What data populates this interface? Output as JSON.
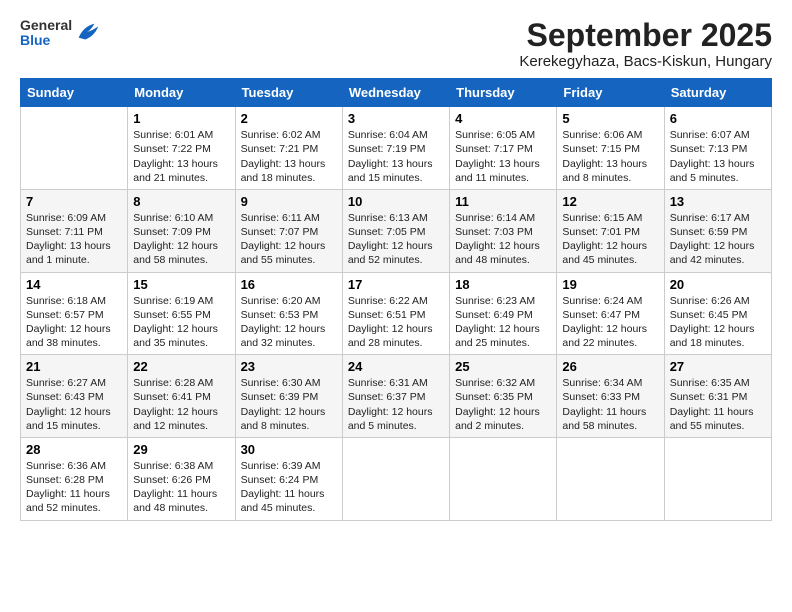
{
  "header": {
    "logo": {
      "general": "General",
      "blue": "Blue"
    },
    "title": "September 2025",
    "subtitle": "Kerekegyhaza, Bacs-Kiskun, Hungary"
  },
  "calendar": {
    "days_of_week": [
      "Sunday",
      "Monday",
      "Tuesday",
      "Wednesday",
      "Thursday",
      "Friday",
      "Saturday"
    ],
    "weeks": [
      [
        {
          "day": "",
          "info": ""
        },
        {
          "day": "1",
          "info": "Sunrise: 6:01 AM\nSunset: 7:22 PM\nDaylight: 13 hours\nand 21 minutes."
        },
        {
          "day": "2",
          "info": "Sunrise: 6:02 AM\nSunset: 7:21 PM\nDaylight: 13 hours\nand 18 minutes."
        },
        {
          "day": "3",
          "info": "Sunrise: 6:04 AM\nSunset: 7:19 PM\nDaylight: 13 hours\nand 15 minutes."
        },
        {
          "day": "4",
          "info": "Sunrise: 6:05 AM\nSunset: 7:17 PM\nDaylight: 13 hours\nand 11 minutes."
        },
        {
          "day": "5",
          "info": "Sunrise: 6:06 AM\nSunset: 7:15 PM\nDaylight: 13 hours\nand 8 minutes."
        },
        {
          "day": "6",
          "info": "Sunrise: 6:07 AM\nSunset: 7:13 PM\nDaylight: 13 hours\nand 5 minutes."
        }
      ],
      [
        {
          "day": "7",
          "info": "Sunrise: 6:09 AM\nSunset: 7:11 PM\nDaylight: 13 hours\nand 1 minute."
        },
        {
          "day": "8",
          "info": "Sunrise: 6:10 AM\nSunset: 7:09 PM\nDaylight: 12 hours\nand 58 minutes."
        },
        {
          "day": "9",
          "info": "Sunrise: 6:11 AM\nSunset: 7:07 PM\nDaylight: 12 hours\nand 55 minutes."
        },
        {
          "day": "10",
          "info": "Sunrise: 6:13 AM\nSunset: 7:05 PM\nDaylight: 12 hours\nand 52 minutes."
        },
        {
          "day": "11",
          "info": "Sunrise: 6:14 AM\nSunset: 7:03 PM\nDaylight: 12 hours\nand 48 minutes."
        },
        {
          "day": "12",
          "info": "Sunrise: 6:15 AM\nSunset: 7:01 PM\nDaylight: 12 hours\nand 45 minutes."
        },
        {
          "day": "13",
          "info": "Sunrise: 6:17 AM\nSunset: 6:59 PM\nDaylight: 12 hours\nand 42 minutes."
        }
      ],
      [
        {
          "day": "14",
          "info": "Sunrise: 6:18 AM\nSunset: 6:57 PM\nDaylight: 12 hours\nand 38 minutes."
        },
        {
          "day": "15",
          "info": "Sunrise: 6:19 AM\nSunset: 6:55 PM\nDaylight: 12 hours\nand 35 minutes."
        },
        {
          "day": "16",
          "info": "Sunrise: 6:20 AM\nSunset: 6:53 PM\nDaylight: 12 hours\nand 32 minutes."
        },
        {
          "day": "17",
          "info": "Sunrise: 6:22 AM\nSunset: 6:51 PM\nDaylight: 12 hours\nand 28 minutes."
        },
        {
          "day": "18",
          "info": "Sunrise: 6:23 AM\nSunset: 6:49 PM\nDaylight: 12 hours\nand 25 minutes."
        },
        {
          "day": "19",
          "info": "Sunrise: 6:24 AM\nSunset: 6:47 PM\nDaylight: 12 hours\nand 22 minutes."
        },
        {
          "day": "20",
          "info": "Sunrise: 6:26 AM\nSunset: 6:45 PM\nDaylight: 12 hours\nand 18 minutes."
        }
      ],
      [
        {
          "day": "21",
          "info": "Sunrise: 6:27 AM\nSunset: 6:43 PM\nDaylight: 12 hours\nand 15 minutes."
        },
        {
          "day": "22",
          "info": "Sunrise: 6:28 AM\nSunset: 6:41 PM\nDaylight: 12 hours\nand 12 minutes."
        },
        {
          "day": "23",
          "info": "Sunrise: 6:30 AM\nSunset: 6:39 PM\nDaylight: 12 hours\nand 8 minutes."
        },
        {
          "day": "24",
          "info": "Sunrise: 6:31 AM\nSunset: 6:37 PM\nDaylight: 12 hours\nand 5 minutes."
        },
        {
          "day": "25",
          "info": "Sunrise: 6:32 AM\nSunset: 6:35 PM\nDaylight: 12 hours\nand 2 minutes."
        },
        {
          "day": "26",
          "info": "Sunrise: 6:34 AM\nSunset: 6:33 PM\nDaylight: 11 hours\nand 58 minutes."
        },
        {
          "day": "27",
          "info": "Sunrise: 6:35 AM\nSunset: 6:31 PM\nDaylight: 11 hours\nand 55 minutes."
        }
      ],
      [
        {
          "day": "28",
          "info": "Sunrise: 6:36 AM\nSunset: 6:28 PM\nDaylight: 11 hours\nand 52 minutes."
        },
        {
          "day": "29",
          "info": "Sunrise: 6:38 AM\nSunset: 6:26 PM\nDaylight: 11 hours\nand 48 minutes."
        },
        {
          "day": "30",
          "info": "Sunrise: 6:39 AM\nSunset: 6:24 PM\nDaylight: 11 hours\nand 45 minutes."
        },
        {
          "day": "",
          "info": ""
        },
        {
          "day": "",
          "info": ""
        },
        {
          "day": "",
          "info": ""
        },
        {
          "day": "",
          "info": ""
        }
      ]
    ]
  }
}
